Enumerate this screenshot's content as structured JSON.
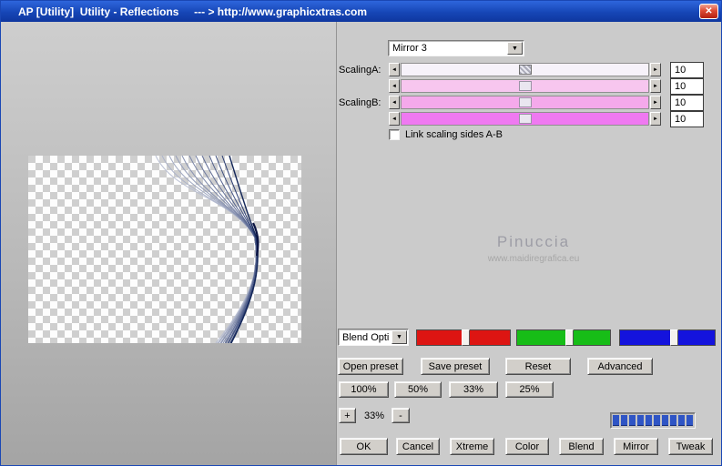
{
  "window": {
    "title": "AP [Utility]  Utility - Reflections     --- > http://www.graphicxtras.com"
  },
  "icons": {
    "close": "✕",
    "dropdown": "▼",
    "left": "◄",
    "right": "►"
  },
  "mirror_select": {
    "value": "Mirror 3"
  },
  "scaling": {
    "label_a": "ScalingA:",
    "label_b": "ScalingB:",
    "values": [
      "10",
      "10",
      "10",
      "10"
    ],
    "track_colors": [
      "#f6f2fa",
      "#f7c6ef",
      "#f5a9eb",
      "#ef79f1"
    ],
    "link_label": "Link scaling sides A-B"
  },
  "watermark": {
    "name": "Pinuccia",
    "site": "www.maidiregrafica.eu"
  },
  "blend_select": {
    "value": "Blend Opti"
  },
  "rgb": {
    "red": "#dd1512",
    "green": "#17bd17",
    "blue": "#1413dd"
  },
  "preset_buttons": {
    "open": "Open preset",
    "save": "Save preset",
    "reset": "Reset",
    "advanced": "Advanced"
  },
  "zoom_buttons": [
    "100%",
    "50%",
    "33%",
    "25%"
  ],
  "stepper": {
    "plus": "+",
    "value": "33%",
    "minus": "-"
  },
  "progress": {
    "segments": 10,
    "color": "#2f55c5"
  },
  "actions": [
    "OK",
    "Cancel",
    "Xtreme",
    "Color",
    "Blend",
    "Mirror",
    "Tweak"
  ]
}
